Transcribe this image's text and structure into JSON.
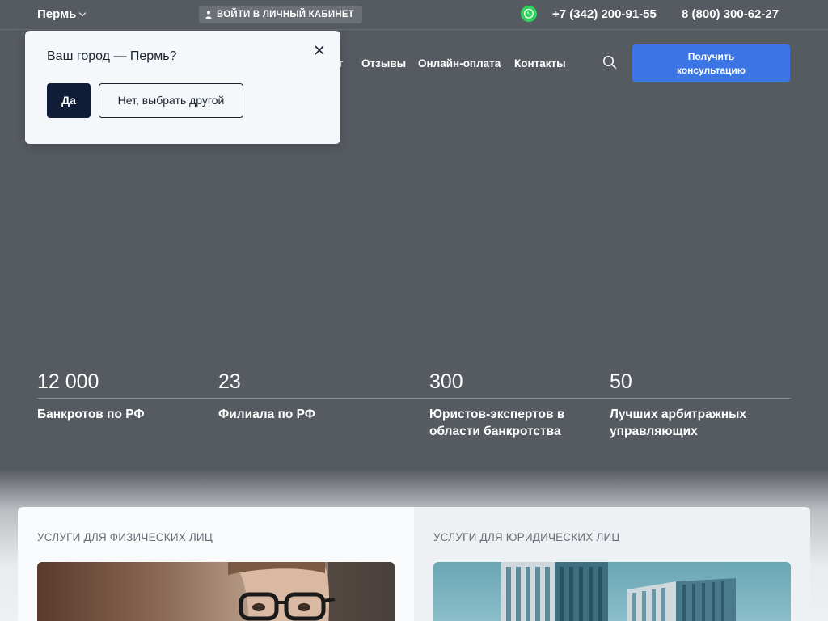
{
  "topbar": {
    "city": "Пермь",
    "cabinet_label": "ВОЙТИ В ЛИЧНЫЙ КАБИНЕТ",
    "phone_local": "+7 (342) 200-91-55",
    "phone_federal": "8 (800) 300-62-27"
  },
  "nav": {
    "items": [
      "г",
      "Отзывы",
      "Онлайн-оплата",
      "Контакты"
    ],
    "cta_line1": "Получить",
    "cta_line2": "консультацию"
  },
  "city_popup": {
    "question": "Ваш город — Пермь?",
    "yes_label": "Да",
    "no_label": "Нет, выбрать другой"
  },
  "stats": [
    {
      "value": "12 000",
      "label_line1": "Банкротов по РФ",
      "label_line2": ""
    },
    {
      "value": "23",
      "label_line1": "Филиала по РФ",
      "label_line2": ""
    },
    {
      "value": "300",
      "label_line1": "Юристов-экспертов в",
      "label_line2": "области банкротства"
    },
    {
      "value": "50",
      "label_line1": "Лучших арбитражных",
      "label_line2": "управляющих"
    }
  ],
  "services": {
    "individuals_title": "УСЛУГИ ДЛЯ ФИЗИЧЕСКИХ ЛИЦ",
    "companies_title": "УСЛУГИ ДЛЯ ЮРИДИЧЕСКИХ ЛИЦ"
  },
  "colors": {
    "accent": "#3b76e4",
    "dark_button": "#0f1e36",
    "background": "#565a61",
    "whatsapp": "#2fd25c"
  },
  "icons": [
    "chevron-down-icon",
    "user-icon",
    "whatsapp-icon",
    "search-icon",
    "close-icon"
  ]
}
